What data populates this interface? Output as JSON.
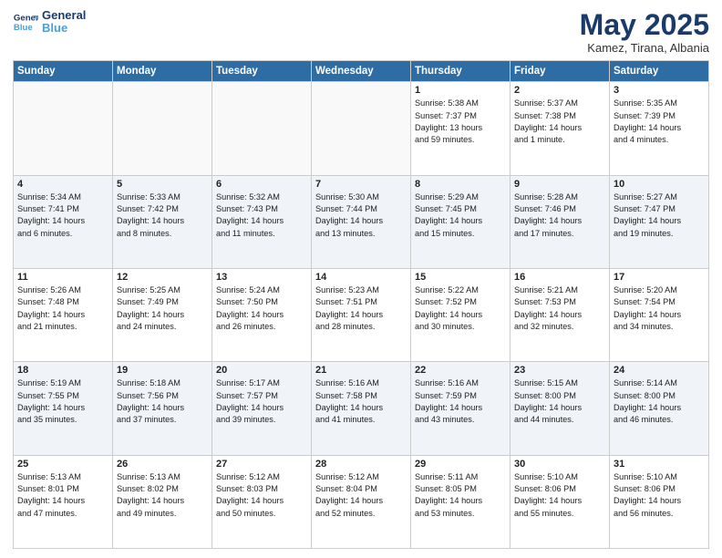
{
  "header": {
    "logo_line1": "General",
    "logo_line2": "Blue",
    "month": "May 2025",
    "location": "Kamez, Tirana, Albania"
  },
  "weekdays": [
    "Sunday",
    "Monday",
    "Tuesday",
    "Wednesday",
    "Thursday",
    "Friday",
    "Saturday"
  ],
  "weeks": [
    [
      {
        "day": "",
        "info": ""
      },
      {
        "day": "",
        "info": ""
      },
      {
        "day": "",
        "info": ""
      },
      {
        "day": "",
        "info": ""
      },
      {
        "day": "1",
        "info": "Sunrise: 5:38 AM\nSunset: 7:37 PM\nDaylight: 13 hours\nand 59 minutes."
      },
      {
        "day": "2",
        "info": "Sunrise: 5:37 AM\nSunset: 7:38 PM\nDaylight: 14 hours\nand 1 minute."
      },
      {
        "day": "3",
        "info": "Sunrise: 5:35 AM\nSunset: 7:39 PM\nDaylight: 14 hours\nand 4 minutes."
      }
    ],
    [
      {
        "day": "4",
        "info": "Sunrise: 5:34 AM\nSunset: 7:41 PM\nDaylight: 14 hours\nand 6 minutes."
      },
      {
        "day": "5",
        "info": "Sunrise: 5:33 AM\nSunset: 7:42 PM\nDaylight: 14 hours\nand 8 minutes."
      },
      {
        "day": "6",
        "info": "Sunrise: 5:32 AM\nSunset: 7:43 PM\nDaylight: 14 hours\nand 11 minutes."
      },
      {
        "day": "7",
        "info": "Sunrise: 5:30 AM\nSunset: 7:44 PM\nDaylight: 14 hours\nand 13 minutes."
      },
      {
        "day": "8",
        "info": "Sunrise: 5:29 AM\nSunset: 7:45 PM\nDaylight: 14 hours\nand 15 minutes."
      },
      {
        "day": "9",
        "info": "Sunrise: 5:28 AM\nSunset: 7:46 PM\nDaylight: 14 hours\nand 17 minutes."
      },
      {
        "day": "10",
        "info": "Sunrise: 5:27 AM\nSunset: 7:47 PM\nDaylight: 14 hours\nand 19 minutes."
      }
    ],
    [
      {
        "day": "11",
        "info": "Sunrise: 5:26 AM\nSunset: 7:48 PM\nDaylight: 14 hours\nand 21 minutes."
      },
      {
        "day": "12",
        "info": "Sunrise: 5:25 AM\nSunset: 7:49 PM\nDaylight: 14 hours\nand 24 minutes."
      },
      {
        "day": "13",
        "info": "Sunrise: 5:24 AM\nSunset: 7:50 PM\nDaylight: 14 hours\nand 26 minutes."
      },
      {
        "day": "14",
        "info": "Sunrise: 5:23 AM\nSunset: 7:51 PM\nDaylight: 14 hours\nand 28 minutes."
      },
      {
        "day": "15",
        "info": "Sunrise: 5:22 AM\nSunset: 7:52 PM\nDaylight: 14 hours\nand 30 minutes."
      },
      {
        "day": "16",
        "info": "Sunrise: 5:21 AM\nSunset: 7:53 PM\nDaylight: 14 hours\nand 32 minutes."
      },
      {
        "day": "17",
        "info": "Sunrise: 5:20 AM\nSunset: 7:54 PM\nDaylight: 14 hours\nand 34 minutes."
      }
    ],
    [
      {
        "day": "18",
        "info": "Sunrise: 5:19 AM\nSunset: 7:55 PM\nDaylight: 14 hours\nand 35 minutes."
      },
      {
        "day": "19",
        "info": "Sunrise: 5:18 AM\nSunset: 7:56 PM\nDaylight: 14 hours\nand 37 minutes."
      },
      {
        "day": "20",
        "info": "Sunrise: 5:17 AM\nSunset: 7:57 PM\nDaylight: 14 hours\nand 39 minutes."
      },
      {
        "day": "21",
        "info": "Sunrise: 5:16 AM\nSunset: 7:58 PM\nDaylight: 14 hours\nand 41 minutes."
      },
      {
        "day": "22",
        "info": "Sunrise: 5:16 AM\nSunset: 7:59 PM\nDaylight: 14 hours\nand 43 minutes."
      },
      {
        "day": "23",
        "info": "Sunrise: 5:15 AM\nSunset: 8:00 PM\nDaylight: 14 hours\nand 44 minutes."
      },
      {
        "day": "24",
        "info": "Sunrise: 5:14 AM\nSunset: 8:00 PM\nDaylight: 14 hours\nand 46 minutes."
      }
    ],
    [
      {
        "day": "25",
        "info": "Sunrise: 5:13 AM\nSunset: 8:01 PM\nDaylight: 14 hours\nand 47 minutes."
      },
      {
        "day": "26",
        "info": "Sunrise: 5:13 AM\nSunset: 8:02 PM\nDaylight: 14 hours\nand 49 minutes."
      },
      {
        "day": "27",
        "info": "Sunrise: 5:12 AM\nSunset: 8:03 PM\nDaylight: 14 hours\nand 50 minutes."
      },
      {
        "day": "28",
        "info": "Sunrise: 5:12 AM\nSunset: 8:04 PM\nDaylight: 14 hours\nand 52 minutes."
      },
      {
        "day": "29",
        "info": "Sunrise: 5:11 AM\nSunset: 8:05 PM\nDaylight: 14 hours\nand 53 minutes."
      },
      {
        "day": "30",
        "info": "Sunrise: 5:10 AM\nSunset: 8:06 PM\nDaylight: 14 hours\nand 55 minutes."
      },
      {
        "day": "31",
        "info": "Sunrise: 5:10 AM\nSunset: 8:06 PM\nDaylight: 14 hours\nand 56 minutes."
      }
    ]
  ]
}
